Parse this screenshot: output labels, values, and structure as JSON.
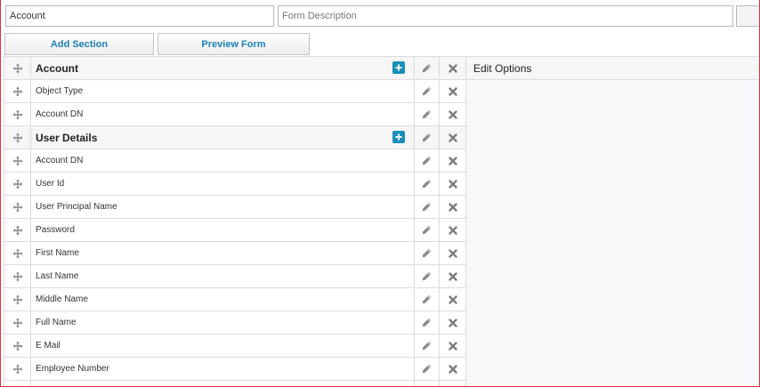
{
  "form": {
    "name_value": "Account",
    "description_placeholder": "Form Description"
  },
  "toolbar": {
    "add_section_label": "Add Section",
    "preview_form_label": "Preview Form"
  },
  "edit_panel": {
    "title": "Edit Options"
  },
  "rows": [
    {
      "type": "section",
      "label": "Account"
    },
    {
      "type": "field",
      "label": "Object Type"
    },
    {
      "type": "field",
      "label": "Account DN"
    },
    {
      "type": "section",
      "label": "User Details"
    },
    {
      "type": "field",
      "label": "Account DN"
    },
    {
      "type": "field",
      "label": "User Id"
    },
    {
      "type": "field",
      "label": "User Principal Name"
    },
    {
      "type": "field",
      "label": "Password"
    },
    {
      "type": "field",
      "label": "First Name"
    },
    {
      "type": "field",
      "label": "Last Name"
    },
    {
      "type": "field",
      "label": "Middle Name"
    },
    {
      "type": "field",
      "label": "Full Name"
    },
    {
      "type": "field",
      "label": "E Mail"
    },
    {
      "type": "field",
      "label": "Employee Number"
    },
    {
      "type": "field",
      "label": ""
    }
  ],
  "icons": {
    "drag": "move-icon",
    "add": "plus-icon",
    "edit": "pencil-icon",
    "delete": "close-icon"
  },
  "colors": {
    "accent": "#1a7fb6",
    "add_button": "#1a8fba",
    "frame_border": "#d9363e",
    "icon_gray": "#8a8a8a"
  }
}
